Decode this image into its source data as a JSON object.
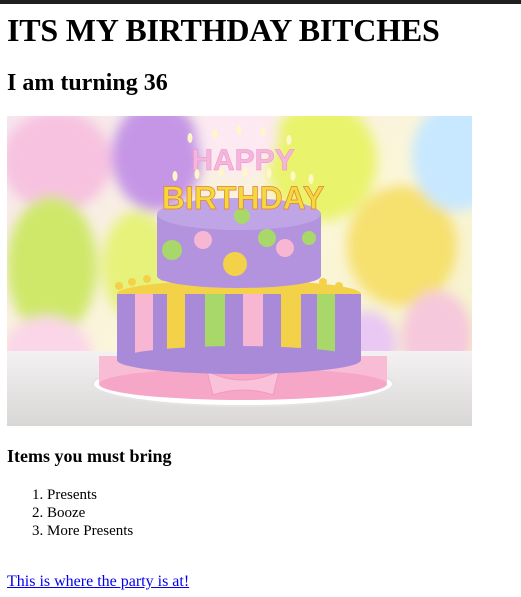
{
  "page": {
    "title": "ITS MY BIRTHDAY BITCHES",
    "subtitle": "I am turning 36"
  },
  "hero_image": {
    "cake_text_line1": "HAPPY",
    "cake_text_line2": "BIRTHDAY",
    "icon": "birthday-cake-photo"
  },
  "items_section": {
    "heading": "Items you must bring",
    "items": [
      "Presents",
      "Booze",
      "More Presents"
    ]
  },
  "party_link": {
    "label": "This is where the party is at!"
  },
  "colors": {
    "link": "#0000ee",
    "cake_purple": "#9b7fcf",
    "cake_pink": "#f4a9c8",
    "cake_yellow": "#f3d34a",
    "cake_green": "#a8d86a"
  }
}
